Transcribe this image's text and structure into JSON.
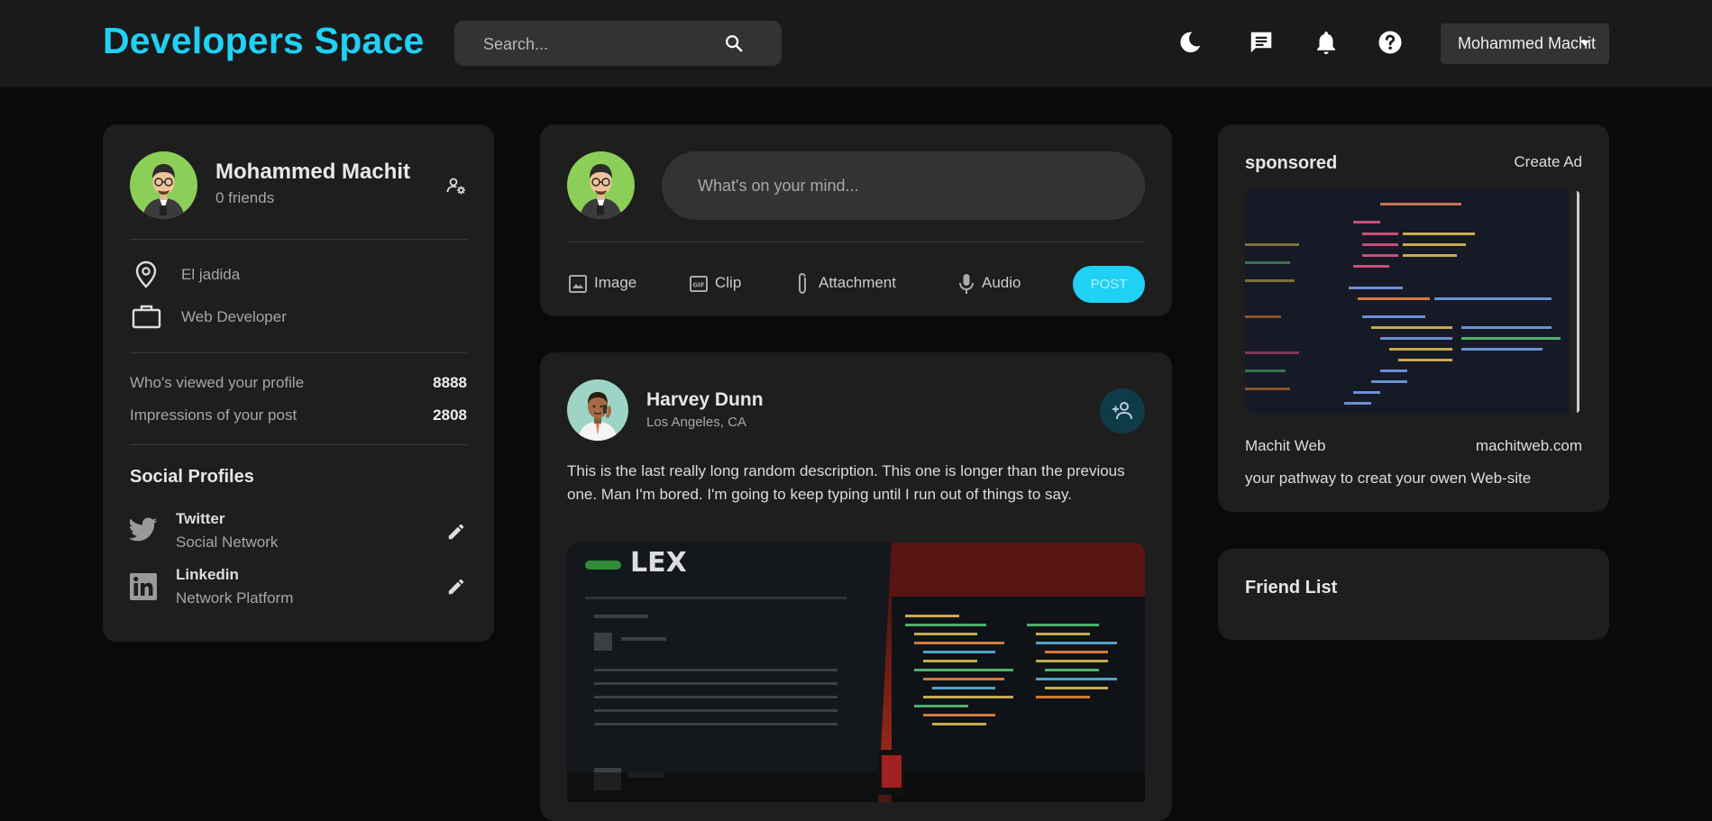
{
  "app": {
    "title": "Developers Space"
  },
  "search": {
    "placeholder": "Search..."
  },
  "nav": {
    "icons": [
      "moon-icon",
      "message-icon",
      "bell-icon",
      "help-icon"
    ],
    "user_name": "Mohammed Machit"
  },
  "colors": {
    "accent": "#1fd1f5",
    "card": "#1e1e1e",
    "background": "#0a0a0a"
  },
  "profile": {
    "name": "Mohammed Machit",
    "friends": "0 friends",
    "location": "El jadida",
    "occupation": "Web Developer",
    "stats": [
      {
        "label": "Who's viewed your profile",
        "value": "8888"
      },
      {
        "label": "Impressions of your post",
        "value": "2808"
      }
    ],
    "social_title": "Social Profiles",
    "socials": [
      {
        "name": "Twitter",
        "type": "Social Network"
      },
      {
        "name": "Linkedin",
        "type": "Network Platform"
      }
    ]
  },
  "composer": {
    "placeholder": "What's on your mind...",
    "actions": [
      "Image",
      "Clip",
      "Attachment",
      "Audio"
    ],
    "post_label": "POST"
  },
  "post": {
    "author": "Harvey Dunn",
    "location": "Los Angeles, CA",
    "description": "This is the last really long random description. This one is longer than the previous one. Man I'm bored. I'm going to keep typing until I run out of things to say.",
    "image_text": "LEX"
  },
  "sponsored": {
    "title": "sponsored",
    "create_label": "Create Ad",
    "name": "Machit Web",
    "url": "machitweb.com",
    "tagline": "your pathway to creat your owen Web-site"
  },
  "friend_list": {
    "title": "Friend List"
  }
}
